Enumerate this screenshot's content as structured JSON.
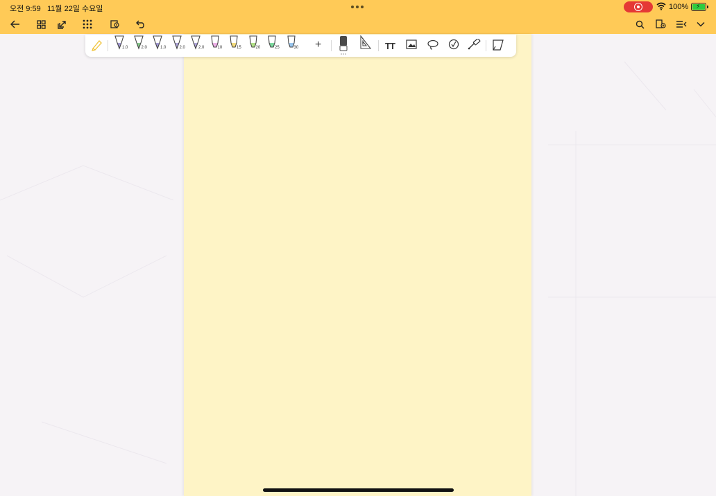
{
  "status_bar": {
    "time": "오전 9:59",
    "date": "11월 22일 수요일",
    "battery": "100%"
  },
  "nav": {
    "left_icons": [
      "back-arrow-icon",
      "grid-view-icon",
      "export-share-icon",
      "apps-dots-icon",
      "page-sync-icon",
      "undo-icon"
    ],
    "right_icons": [
      "search-icon",
      "page-add-icon",
      "more-menu-icon",
      "chevron-down-icon"
    ]
  },
  "toolbar": {
    "pens": [
      {
        "size": "1.0",
        "color": "#8b80c8"
      },
      {
        "size": "2.0",
        "color": "#6cc070"
      },
      {
        "size": "1.0",
        "color": "#8b80c8"
      },
      {
        "size": "2.0",
        "color": "#9a8fd0"
      },
      {
        "size": "2.0",
        "color": "#9a8fd0"
      }
    ],
    "highlighters": [
      {
        "size": "10",
        "color": "#e79be0"
      },
      {
        "size": "15",
        "color": "#f1d35c"
      },
      {
        "size": "20",
        "color": "#9dd86a"
      },
      {
        "size": "25",
        "color": "#5ccf86"
      },
      {
        "size": "30",
        "color": "#7fb7e8"
      }
    ],
    "add_label": "+",
    "text_tool_label": "TT"
  },
  "colors": {
    "accent": "#ffca57",
    "page": "#fef4c6",
    "background": "#f6f3f6"
  }
}
